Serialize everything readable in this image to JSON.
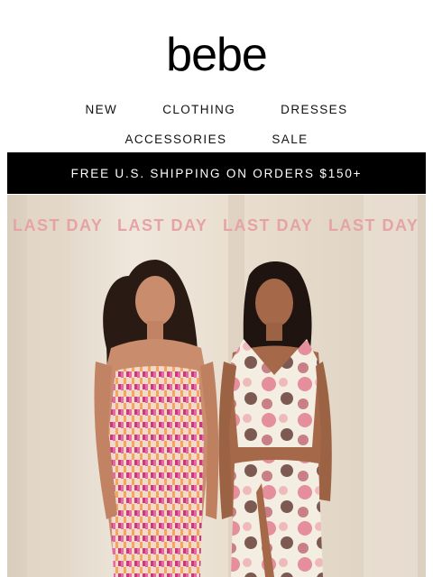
{
  "brand": {
    "logo_text": "bebe"
  },
  "nav": {
    "row1": [
      "NEW",
      "CLOTHING",
      "DRESSES"
    ],
    "row2": [
      "ACCESSORIES",
      "SALE"
    ]
  },
  "promo_bar": {
    "text": "FREE U.S. SHIPPING ON ORDERS $150+"
  },
  "hero": {
    "banner_texts": [
      "LAST DAY",
      "LAST DAY",
      "LAST DAY",
      "LAST DAY"
    ],
    "accent_color": "#e6a3a7"
  },
  "colors": {
    "promo_bar_bg": "#000000",
    "promo_bar_text": "#ffffff",
    "hero_bg": "#ece3d6"
  }
}
